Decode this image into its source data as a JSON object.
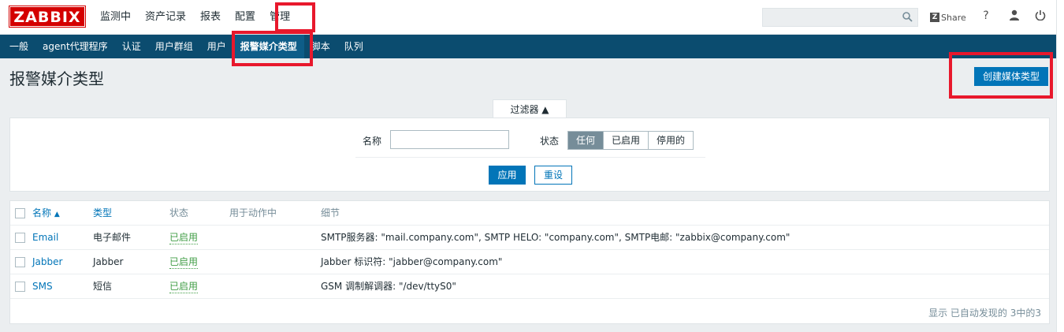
{
  "header": {
    "logo": "ZABBIX",
    "menu": [
      "监测中",
      "资产记录",
      "报表",
      "配置",
      "管理"
    ],
    "share_label": "Share",
    "share_z": "Z",
    "help_label": "?"
  },
  "subnav": {
    "items": [
      "一般",
      "agent代理程序",
      "认证",
      "用户群组",
      "用户",
      "报警媒介类型",
      "脚本",
      "队列"
    ],
    "active_index": 5
  },
  "page": {
    "title": "报警媒介类型",
    "create_button": "创建媒体类型"
  },
  "filter": {
    "tab_label": "过滤器 ▲",
    "name_label": "名称",
    "name_value": "",
    "status_label": "状态",
    "status_options": [
      "任何",
      "已启用",
      "停用的"
    ],
    "status_selected": "任何",
    "apply_label": "应用",
    "reset_label": "重设"
  },
  "table": {
    "headers": {
      "name": "名称",
      "sort_arrow": "▲",
      "type": "类型",
      "status": "状态",
      "used_in_actions": "用于动作中",
      "details": "细节"
    },
    "rows": [
      {
        "name": "Email",
        "type": "电子邮件",
        "status": "已启用",
        "details": "SMTP服务器: \"mail.company.com\", SMTP HELO: \"company.com\", SMTP电邮: \"zabbix@company.com\""
      },
      {
        "name": "Jabber",
        "type": "Jabber",
        "status": "已启用",
        "details": "Jabber 标识符: \"jabber@company.com\""
      },
      {
        "name": "SMS",
        "type": "短信",
        "status": "已启用",
        "details": "GSM 调制解调器: \"/dev/ttyS0\""
      }
    ],
    "footer": "显示 已自动发现的 3中的3"
  },
  "colors": {
    "brand_red": "#d40000",
    "nav_blue": "#0b4c6f",
    "button_blue": "#0275b8",
    "enabled_green": "#429e47",
    "highlight_red": "#e8182c"
  }
}
